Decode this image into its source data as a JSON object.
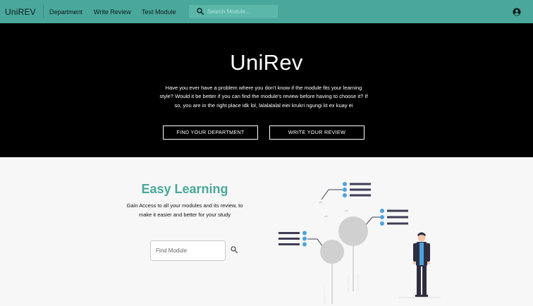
{
  "navbar": {
    "brand": "UniREV",
    "links": [
      "Department",
      "Write Review",
      "Test Module"
    ],
    "search_placeholder": "Search Module...",
    "account_icon": "account-circle-icon"
  },
  "hero": {
    "title": "UniRev",
    "description": "Have you ever have a problem where you don't know if the module fits your learning style? Would it be better if you can find the module's review before having to choose it? If so, you are in the right place idk lol, lalalalalal eiei krukri ngungi kt ex kuay ei",
    "buttons": [
      "FIND YOUR DEPARTMENT",
      "WRITE YOUR REVIEW"
    ]
  },
  "feature": {
    "title": "Easy Learning",
    "description": "Gain Access to all your modules and its review, to make it easier and better for your study",
    "find_placeholder": "Find Module",
    "search_icon": "search-icon"
  },
  "colors": {
    "accent": "#4aa79b",
    "hero_bg": "#000000",
    "page_bg": "#f7f7f7",
    "illustration_blue": "#4aa3df",
    "illustration_dark": "#3f3d56"
  }
}
